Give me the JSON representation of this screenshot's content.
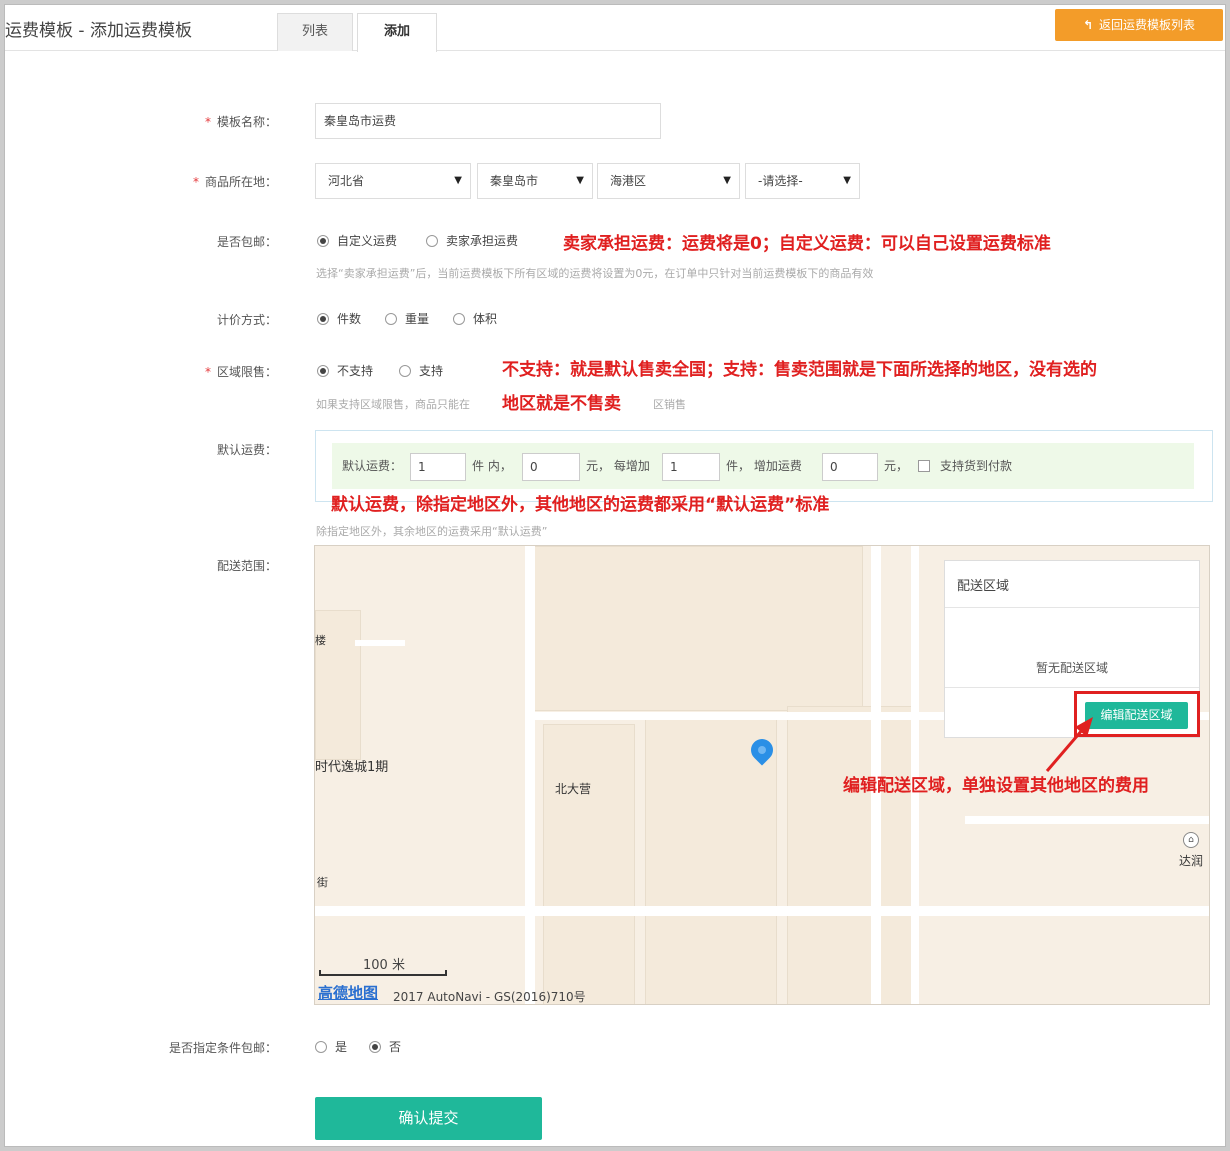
{
  "header": {
    "page_title": "运费模板 - 添加运费模板",
    "tabs": [
      {
        "label": "列表",
        "active": false
      },
      {
        "label": "添加",
        "active": true
      }
    ],
    "back_button": "返回运费模板列表",
    "back_icon": "return-arrow-icon"
  },
  "form": {
    "template_name": {
      "label": "模板名称：",
      "required": true,
      "value": "秦皇岛市运费"
    },
    "location": {
      "label": "商品所在地：",
      "required": true,
      "province": "河北省",
      "city": "秦皇岛市",
      "district": "海港区",
      "street": "-请选择-"
    },
    "free_shipping": {
      "label": "是否包邮：",
      "options": [
        "自定义运费",
        "卖家承担运费"
      ],
      "selected": "自定义运费",
      "hint": "选择“卖家承担运费”后，当前运费模板下所有区域的运费将设置为0元，在订单中只针对当前运费模板下的商品有效"
    },
    "pricing": {
      "label": "计价方式：",
      "options": [
        "件数",
        "重量",
        "体积"
      ],
      "selected": "件数"
    },
    "region_limit": {
      "label": "区域限售：",
      "required": true,
      "options": [
        "不支持",
        "支持"
      ],
      "selected": "不支持",
      "hint_left": "如果支持区域限售，商品只能在",
      "hint_right": "区销售"
    },
    "default_fee": {
      "label": "默认运费：",
      "prefix": "默认运费：",
      "first_count": "1",
      "text_within": "件 内，",
      "first_fee": "0",
      "text_each": "元， 每增加",
      "add_count": "1",
      "text_add": "件， 增加运费",
      "add_fee": "0",
      "text_yuan": "元，",
      "cod_label": "支持货到付款",
      "cod_checked": false,
      "hint": "除指定地区外，其余地区的运费采用“默认运费”"
    },
    "delivery_range": {
      "label": "配送范围：",
      "map": {
        "labels": [
          "时代逸城1期",
          "北大营",
          "楼",
          "街",
          "达润"
        ],
        "scale": "100 米",
        "logo": "高德地图",
        "copyright": "2017 AutoNavi - GS(2016)710号",
        "pin_icon": "location-pin-icon"
      },
      "panel": {
        "title": "配送区域",
        "empty_text": "暂无配送区域",
        "edit_button": "编辑配送区域"
      }
    },
    "conditional_free": {
      "label": "是否指定条件包邮：",
      "options": [
        "是",
        "否"
      ],
      "selected": "否"
    },
    "submit": "确认提交"
  },
  "annotations": {
    "shipping": "卖家承担运费：运费将是0；自定义运费：可以自己设置运费标准",
    "region_line1": "不支持：就是默认售卖全国；支持：售卖范围就是下面所选择的地区，没有选的",
    "region_line2": "地区就是不售卖",
    "default_fee": "默认运费，除指定地区外，其他地区的运费都采用“默认运费”标准",
    "edit_zone": "编辑配送区域，单独设置其他地区的费用",
    "color": "#e02020"
  },
  "colors": {
    "accent_green": "#1fb89a",
    "back_orange": "#f39c29",
    "required_red": "#e4393c"
  }
}
